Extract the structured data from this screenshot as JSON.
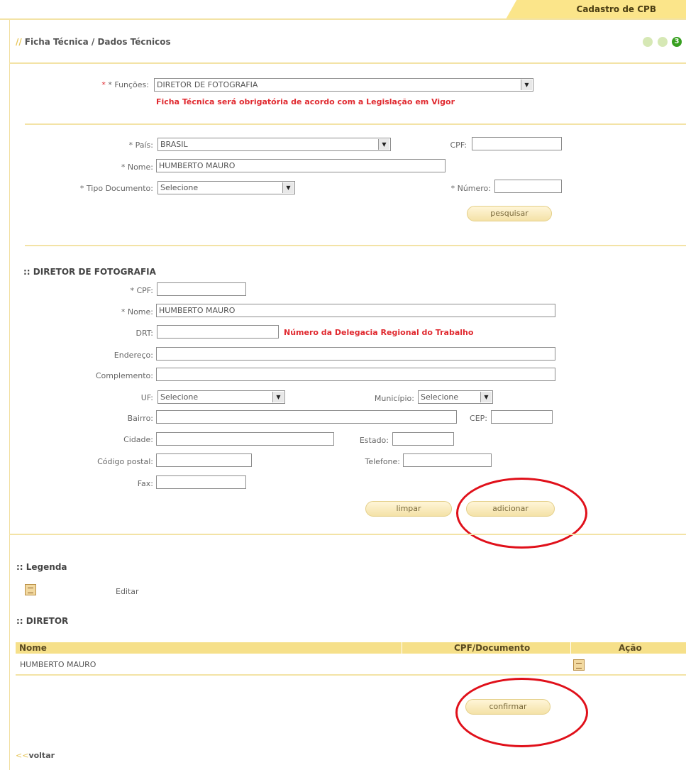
{
  "tab": {
    "label": "Cadastro de CPB"
  },
  "page": {
    "breadcrumb": "Ficha Técnica / Dados Técnicos",
    "step_current": "3"
  },
  "funcoes": {
    "label": "* Funções:",
    "value": "DIRETOR DE FOTOGRAFIA",
    "notice": "Ficha Técnica será obrigatória de acordo com a Legislação em Vigor"
  },
  "search": {
    "pais_label": "* País:",
    "pais_value": "BRASIL",
    "cpf_label": "CPF:",
    "cpf_value": "",
    "nome_label": "* Nome:",
    "nome_value": "HUMBERTO MAURO",
    "tipo_doc_label": "* Tipo Documento:",
    "tipo_doc_value": "Selecione",
    "numero_label": "* Número:",
    "numero_value": "",
    "pesquisar_label": "pesquisar"
  },
  "detail": {
    "section_title": ":: DIRETOR DE FOTOGRAFIA",
    "cpf_label": "* CPF:",
    "cpf_value": "",
    "nome_label": "* Nome:",
    "nome_value": "HUMBERTO MAURO",
    "drt_label": "DRT:",
    "drt_value": "",
    "drt_hint": "Número da Delegacia Regional do Trabalho",
    "endereco_label": "Endereço:",
    "endereco_value": "",
    "complemento_label": "Complemento:",
    "complemento_value": "",
    "uf_label": "UF:",
    "uf_value": "Selecione",
    "municipio_label": "Município:",
    "municipio_value": "Selecione",
    "bairro_label": "Bairro:",
    "bairro_value": "",
    "cep_label": "CEP:",
    "cep_value": "",
    "cidade_label": "Cidade:",
    "cidade_value": "",
    "estado_label": "Estado:",
    "estado_value": "",
    "codigo_postal_label": "Código postal:",
    "codigo_postal_value": "",
    "telefone_label": "Telefone:",
    "telefone_value": "",
    "fax_label": "Fax:",
    "fax_value": "",
    "limpar_label": "limpar",
    "adicionar_label": "adicionar"
  },
  "legend": {
    "title": ":: Legenda",
    "edit_label": "Editar"
  },
  "director_table": {
    "title": ":: DIRETOR",
    "columns": [
      "Nome",
      "CPF/Documento",
      "Ação"
    ],
    "rows": [
      {
        "nome": "HUMBERTO MAURO",
        "cpf_documento": ""
      }
    ]
  },
  "confirmar_label": "confirmar",
  "voltar_label": "voltar",
  "colors": {
    "accent": "#f6e08a",
    "required": "#e0292f",
    "annotation": "#e0101a",
    "step_active": "#38a020"
  }
}
